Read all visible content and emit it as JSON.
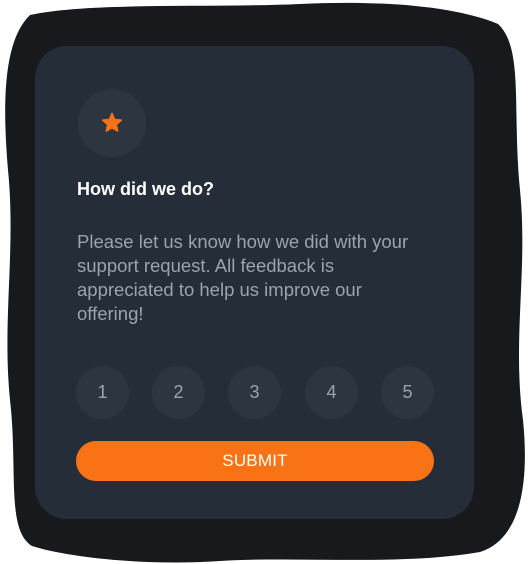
{
  "colors": {
    "card_background": "#252d38",
    "backdrop": "#17191d",
    "accent": "#f97316",
    "muted_text": "#9aa3af",
    "circle_background": "#2d3540"
  },
  "header": {
    "icon": "star-icon"
  },
  "content": {
    "title": "How did we do?",
    "description": "Please let us know how we did with your support request. All feedback is appreciated to help us improve our offering!"
  },
  "ratings": [
    {
      "label": "1"
    },
    {
      "label": "2"
    },
    {
      "label": "3"
    },
    {
      "label": "4"
    },
    {
      "label": "5"
    }
  ],
  "actions": {
    "submit_label": "SUBMIT"
  }
}
